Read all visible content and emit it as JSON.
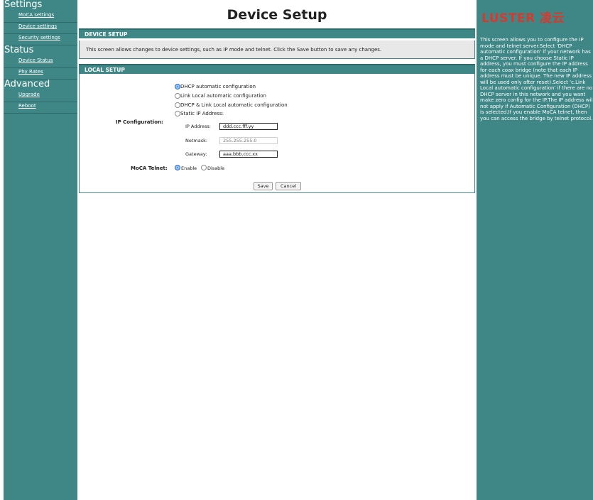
{
  "sidebar": {
    "sections": [
      {
        "title": "Settings",
        "items": [
          "MoCA settings",
          "Device settings",
          "Security settings"
        ]
      },
      {
        "title": "Status",
        "items": [
          "Device Status",
          "Phy Rates"
        ]
      },
      {
        "title": "Advanced",
        "items": [
          "Upgrade",
          "Reboot"
        ]
      }
    ]
  },
  "page": {
    "title": "Device Setup"
  },
  "device_setup": {
    "header": "DEVICE SETUP",
    "description": "This screen allows changes to device settings, such as IP mode and telnet. Click the Save button to save any changes."
  },
  "local_setup": {
    "header": "LOCAL SETUP",
    "ip_config_label": "IP Configuration:",
    "options": [
      {
        "label": "DHCP automatic configuration",
        "selected": true
      },
      {
        "label": "Link Local automatic configuration",
        "selected": false
      },
      {
        "label": "DHCP & Link Local automatic configuration",
        "selected": false
      },
      {
        "label": "Static IP Address:",
        "selected": false
      }
    ],
    "ip_address_label": "IP Address:",
    "ip_address_value": "ddd.ccc.fff.yy",
    "netmask_label": "Netmask:",
    "netmask_value": "255.255.255.0",
    "gateway_label": "Gateway:",
    "gateway_value": "aaa.bbb.ccc.xx",
    "telnet_label": "MoCA Telnet:",
    "telnet_enable": "Enable",
    "telnet_disable": "Disable",
    "telnet_selected": "Enable",
    "save_label": "Save",
    "cancel_label": "Cancel"
  },
  "right_panel": {
    "logo": "LUSTER 凌云",
    "help_text": "This screen allows you to configure the IP mode and telnet server.Select 'DHCP automatic configuration' if your network has a DHCP server. If you choose Static IP address, you must configure the IP address for each coax bridge (note that each IP address must be unique. The new IP address will be used only after reset).Select 'c.Link Local automatic configuration' if there are no DHCP server in this network and you want make zero config for the IP.The IP address will not apply if Automatic Configuration (DHCP) is selected.If you enable MoCA telnet, then you can access the bridge by telnet protocol."
  },
  "colors": {
    "teal": "#3f8787",
    "logo_red": "#d8392c"
  }
}
